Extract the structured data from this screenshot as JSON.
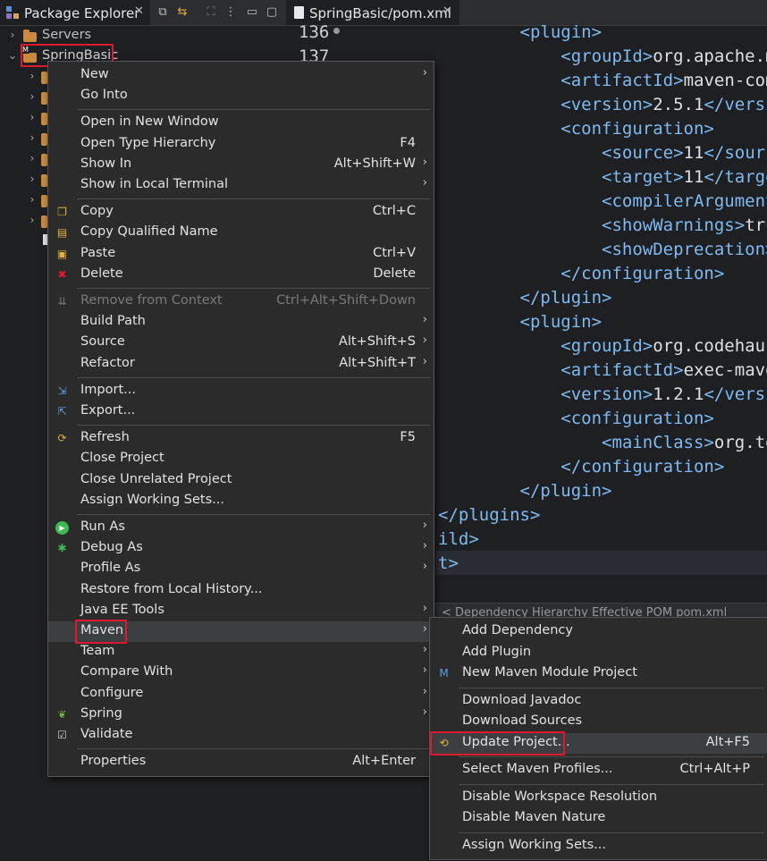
{
  "package_explorer": {
    "title": "Package Explorer",
    "tree": [
      {
        "label": "Servers",
        "expanded": false
      },
      {
        "label": "SpringBasic",
        "expanded": true,
        "selected": true
      }
    ]
  },
  "editor": {
    "tab_title": "SpringBasic/pom.xml",
    "line_numbers": [
      "136",
      "137"
    ],
    "code_lines": [
      {
        "indent": "            ",
        "parts": [
          [
            "tag",
            "<plugin>"
          ]
        ]
      },
      {
        "indent": "                ",
        "parts": [
          [
            "tag",
            "<groupId>"
          ],
          [
            "txt",
            "org.apache.m"
          ]
        ]
      },
      {
        "indent": "                ",
        "parts": [
          [
            "tag",
            "<artifactId>"
          ],
          [
            "txt",
            "maven-com"
          ]
        ]
      },
      {
        "indent": "                ",
        "parts": [
          [
            "tag",
            "<version>"
          ],
          [
            "txt",
            "2.5.1"
          ],
          [
            "tag",
            "</versi"
          ]
        ]
      },
      {
        "indent": "                ",
        "parts": [
          [
            "tag",
            "<configuration>"
          ]
        ]
      },
      {
        "indent": "                    ",
        "parts": [
          [
            "tag",
            "<source>"
          ],
          [
            "txt",
            "11"
          ],
          [
            "tag",
            "</sourc"
          ]
        ]
      },
      {
        "indent": "                    ",
        "parts": [
          [
            "tag",
            "<target>"
          ],
          [
            "txt",
            "11"
          ],
          [
            "tag",
            "</targe"
          ]
        ]
      },
      {
        "indent": "                    ",
        "parts": [
          [
            "tag",
            "<compilerArgument"
          ]
        ]
      },
      {
        "indent": "                    ",
        "parts": [
          [
            "tag",
            "<showWarnings>"
          ],
          [
            "txt",
            "tru"
          ]
        ]
      },
      {
        "indent": "                    ",
        "parts": [
          [
            "tag",
            "<showDeprecation>"
          ]
        ]
      },
      {
        "indent": "                ",
        "parts": [
          [
            "tag",
            "</configuration>"
          ]
        ]
      },
      {
        "indent": "            ",
        "parts": [
          [
            "tag",
            "</plugin>"
          ]
        ]
      },
      {
        "indent": "            ",
        "parts": [
          [
            "tag",
            "<plugin>"
          ]
        ]
      },
      {
        "indent": "                ",
        "parts": [
          [
            "tag",
            "<groupId>"
          ],
          [
            "txt",
            "org.codehaus"
          ]
        ]
      },
      {
        "indent": "                ",
        "parts": [
          [
            "tag",
            "<artifactId>"
          ],
          [
            "txt",
            "exec-mave"
          ]
        ]
      },
      {
        "indent": "                ",
        "parts": [
          [
            "tag",
            "<version>"
          ],
          [
            "txt",
            "1.2.1"
          ],
          [
            "tag",
            "</versi"
          ]
        ]
      },
      {
        "indent": "                ",
        "parts": [
          [
            "tag",
            "<configuration>"
          ]
        ]
      },
      {
        "indent": "                    ",
        "parts": [
          [
            "tag",
            "<mainClass>"
          ],
          [
            "txt",
            "org.te"
          ]
        ]
      },
      {
        "indent": "                ",
        "parts": [
          [
            "tag",
            "</configuration>"
          ]
        ]
      },
      {
        "indent": "            ",
        "parts": [
          [
            "tag",
            "</plugin>"
          ]
        ]
      },
      {
        "indent": "",
        "parts": [
          [
            "tag",
            "</plugins>"
          ]
        ]
      },
      {
        "indent": "",
        "parts": [
          [
            "tag",
            "ild>"
          ]
        ]
      },
      {
        "indent": "",
        "parts": [
          [
            "tag",
            "t>"
          ]
        ]
      }
    ],
    "bottom_tabs": "< Dependency Hierarchy  Effective POM  pom.xml"
  },
  "context_menu": {
    "items": [
      {
        "label": "New",
        "submenu": true
      },
      {
        "label": "Go Into"
      },
      {
        "sep": true
      },
      {
        "label": "Open in New Window"
      },
      {
        "label": "Open Type Hierarchy",
        "shortcut": "F4"
      },
      {
        "label": "Show In",
        "shortcut": "Alt+Shift+W",
        "submenu": true
      },
      {
        "label": "Show in Local Terminal",
        "submenu": true
      },
      {
        "sep": true
      },
      {
        "label": "Copy",
        "shortcut": "Ctrl+C",
        "icon": "copy-icon"
      },
      {
        "label": "Copy Qualified Name",
        "icon": "copy-qualified-icon"
      },
      {
        "label": "Paste",
        "shortcut": "Ctrl+V",
        "icon": "paste-icon"
      },
      {
        "label": "Delete",
        "shortcut": "Delete",
        "icon": "delete-icon"
      },
      {
        "sep": true
      },
      {
        "label": "Remove from Context",
        "shortcut": "Ctrl+Alt+Shift+Down",
        "icon": "remove-context-icon",
        "disabled": true
      },
      {
        "label": "Build Path",
        "submenu": true
      },
      {
        "label": "Source",
        "shortcut": "Alt+Shift+S",
        "submenu": true
      },
      {
        "label": "Refactor",
        "shortcut": "Alt+Shift+T",
        "submenu": true
      },
      {
        "sep": true
      },
      {
        "label": "Import...",
        "icon": "import-icon"
      },
      {
        "label": "Export...",
        "icon": "export-icon"
      },
      {
        "sep": true
      },
      {
        "label": "Refresh",
        "shortcut": "F5",
        "icon": "refresh-icon"
      },
      {
        "label": "Close Project"
      },
      {
        "label": "Close Unrelated Project"
      },
      {
        "label": "Assign Working Sets..."
      },
      {
        "sep": true
      },
      {
        "label": "Run As",
        "submenu": true,
        "icon": "run-icon"
      },
      {
        "label": "Debug As",
        "submenu": true,
        "icon": "debug-icon"
      },
      {
        "label": "Profile As",
        "submenu": true
      },
      {
        "label": "Restore from Local History..."
      },
      {
        "label": "Java EE Tools",
        "submenu": true
      },
      {
        "label": "Maven",
        "submenu": true,
        "active": true
      },
      {
        "label": "Team",
        "submenu": true
      },
      {
        "label": "Compare With",
        "submenu": true
      },
      {
        "label": "Configure",
        "submenu": true
      },
      {
        "label": "Spring",
        "submenu": true,
        "icon": "spring-icon"
      },
      {
        "label": "Validate",
        "icon": "validate-icon"
      },
      {
        "sep": true
      },
      {
        "label": "Properties",
        "shortcut": "Alt+Enter"
      }
    ]
  },
  "maven_submenu": {
    "items": [
      {
        "label": "Add Dependency"
      },
      {
        "label": "Add Plugin"
      },
      {
        "label": "New Maven Module Project",
        "icon": "maven-module-icon"
      },
      {
        "sep": true
      },
      {
        "label": "Download Javadoc"
      },
      {
        "label": "Download Sources"
      },
      {
        "label": "Update Project...",
        "shortcut": "Alt+F5",
        "icon": "update-project-icon",
        "active": true
      },
      {
        "sep": true
      },
      {
        "label": "Select Maven Profiles...",
        "shortcut": "Ctrl+Alt+P"
      },
      {
        "sep": true
      },
      {
        "label": "Disable Workspace Resolution"
      },
      {
        "label": "Disable Maven Nature"
      },
      {
        "sep": true
      },
      {
        "label": "Assign Working Sets..."
      }
    ]
  },
  "colors": {
    "highlight_border": "#e0182d",
    "tag_color": "#7fbaf0"
  }
}
